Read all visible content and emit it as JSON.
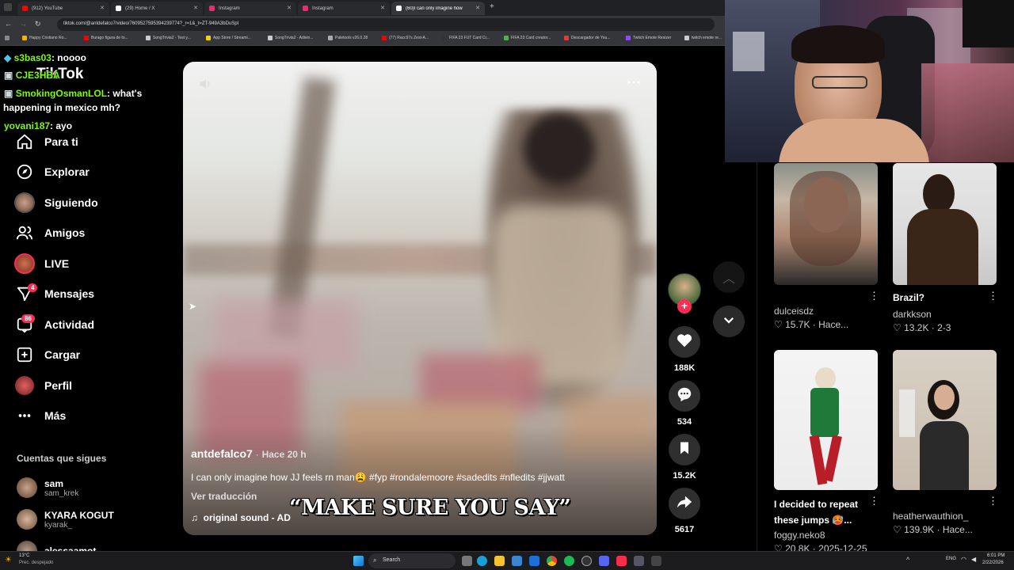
{
  "browser": {
    "tabs": [
      {
        "title": "(912) YouTube",
        "color": "#ff0000"
      },
      {
        "title": "(29) Home / X",
        "color": "#ffffff"
      },
      {
        "title": "Instagram",
        "color": "#e1306c"
      },
      {
        "title": "Instagram",
        "color": "#e1306c"
      },
      {
        "title": "(60)I can only imagine how",
        "color": "#ffffff"
      }
    ],
    "url": "tiktok.com/@antdefalco7/video/7609527595394239774?_r=1&_t=ZT-949A3bDuSpI",
    "bookmarks": [
      "Happy Cristiano Ro...",
      "Burago figura de to...",
      "SongTrivia2 - Test y...",
      "App Store / Streami...",
      "SongTrivia2 - Adivin...",
      "Paletools v26.0.28",
      "(77) Racc97s Zest-A...",
      "FIFA 23 FUT Card Cr...",
      "FIFA 23 Card creator...",
      "Descargador de You...",
      "Twitch Emote Resizer",
      "twitch emote re..."
    ]
  },
  "chat": [
    {
      "user": "s3bas03",
      "text": ": noooo"
    },
    {
      "user": "CJE3HBA",
      "text": ""
    },
    {
      "user": "SmokingOsmanLOL",
      "text": ": what's"
    },
    {
      "user": "",
      "text": "happening in mexico mh?"
    },
    {
      "user": "yovani187",
      "text": ": ayo"
    }
  ],
  "sidebar": {
    "logo": "TikTok",
    "items": [
      {
        "label": "Para ti",
        "icon": "home-icon"
      },
      {
        "label": "Explorar",
        "icon": "compass-icon"
      },
      {
        "label": "Siguiendo",
        "icon": "following-avatar-icon"
      },
      {
        "label": "Amigos",
        "icon": "friends-icon"
      },
      {
        "label": "LIVE",
        "icon": "live-icon"
      },
      {
        "label": "Mensajes",
        "icon": "messages-icon",
        "badge": "4"
      },
      {
        "label": "Actividad",
        "icon": "activity-icon",
        "badge": "86"
      },
      {
        "label": "Cargar",
        "icon": "upload-icon"
      },
      {
        "label": "Perfil",
        "icon": "profile-icon"
      },
      {
        "label": "Más",
        "icon": "more-icon"
      }
    ],
    "following_title": "Cuentas que sigues",
    "following": [
      {
        "name": "sam",
        "handle": "sam_krek"
      },
      {
        "name": "KYARA KOGUT",
        "handle": "kyarak_"
      },
      {
        "name": "alessaamot",
        "handle": ""
      }
    ]
  },
  "video": {
    "author": "antdefalco7",
    "time": "Hace 20 h",
    "separator": "·",
    "caption": "I can only imagine how JJ feels rn man😩 #fyp #rondalemoore #sadedits #nfledits #jjwatt",
    "translate": "Ver traducción",
    "sound": "original sound - AD",
    "subtitle": "“MAKE SURE YOU SAY”"
  },
  "actions": {
    "likes": "188K",
    "comments": "534",
    "saves": "15.2K",
    "shares": "5617",
    "follow": "+"
  },
  "suggestions": [
    {
      "caption": "",
      "user": "dulceisdz",
      "likes": "15.7K",
      "time": "Hace..."
    },
    {
      "caption": "Brazil?",
      "user": "darkkson",
      "likes": "13.2K",
      "time": "2-3"
    },
    {
      "caption": "I decided to repeat these jumps 🥵...",
      "user": "foggy.neko8",
      "likes": "20.8K",
      "time": "2025-12-25"
    },
    {
      "caption": "",
      "user": "heatherwauthion_",
      "likes": "139.9K",
      "time": "Hace..."
    }
  ],
  "taskbar": {
    "temp": "13°C",
    "weather": "Prec. despejado",
    "search": "Search",
    "lang": "ENG",
    "time": "6:01 PM",
    "date": "2/22/2026"
  }
}
